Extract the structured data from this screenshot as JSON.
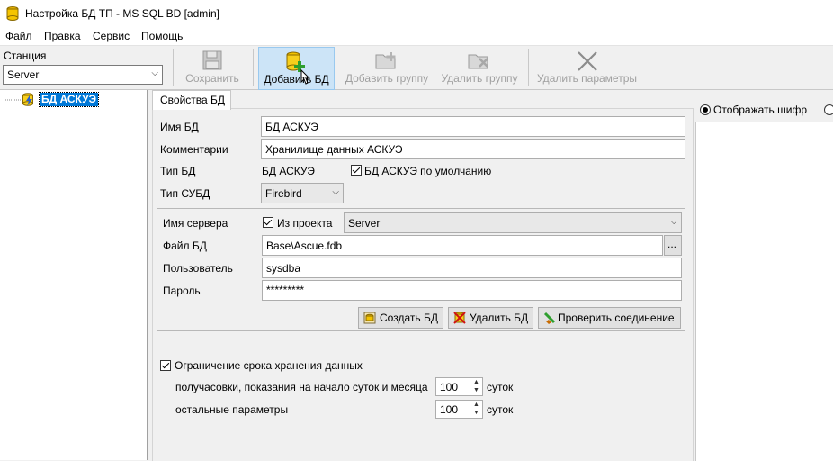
{
  "window": {
    "title": "Настройка БД ТП - MS SQL BD [admin]"
  },
  "menu": [
    "Файл",
    "Правка",
    "Сервис",
    "Помощь"
  ],
  "station": {
    "label": "Станция",
    "value": "Server"
  },
  "toolbar": {
    "save": "Сохранить",
    "add_db": "Добавить БД",
    "add_group": "Добавить группу",
    "delete_group": "Удалить группу",
    "delete_params": "Удалить параметры"
  },
  "tree": {
    "node": "БД АСКУЭ"
  },
  "tab": {
    "label": "Свойства БД"
  },
  "form": {
    "db_name_label": "Имя БД",
    "db_name": "БД АСКУЭ",
    "comment_label": "Комментарии",
    "comment": "Хранилище данных АСКУЭ",
    "db_type_label": "Тип БД",
    "db_type": "БД АСКУЭ",
    "default_label": "БД АСКУЭ по умолчанию",
    "dbms_label": "Тип СУБД",
    "dbms": "Firebird"
  },
  "conn": {
    "server_label": "Имя сервера",
    "from_project_label": "Из проекта",
    "server": "Server",
    "file_label": "Файл БД",
    "file": "Base\\Ascue.fdb",
    "browse": "...",
    "user_label": "Пользователь",
    "user": "sysdba",
    "password_label": "Пароль",
    "password": "*********",
    "create_btn": "Создать БД",
    "delete_btn": "Удалить БД",
    "check_btn": "Проверить соединение"
  },
  "retention": {
    "label": "Ограничение срока хранения данных",
    "row1_label": "получасовки, показания на начало суток и месяца",
    "row1_value": "100",
    "row2_label": "остальные параметры",
    "row2_value": "100",
    "unit": "суток"
  },
  "right": {
    "show_cipher": "Отображать шифр"
  }
}
